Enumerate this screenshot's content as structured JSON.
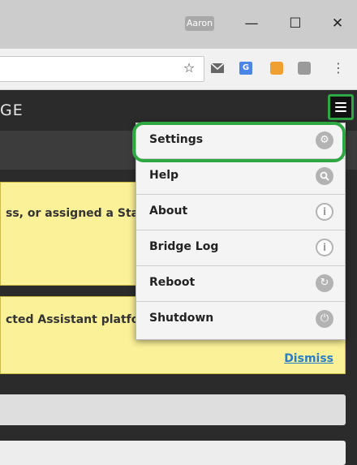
{
  "browser": {
    "user_name": "Aaron",
    "window_controls": {
      "minimize": "—",
      "maximize": "☐",
      "close": "✕"
    },
    "toolbar_icons": [
      "star-icon",
      "mail-icon",
      "translate-icon",
      "extension-orange-icon",
      "extension-grey-icon",
      "kebab-menu-icon"
    ]
  },
  "app": {
    "title_fragment": "GE",
    "menu_items": [
      {
        "label": "Settings",
        "icon": "gear-icon"
      },
      {
        "label": "Help",
        "icon": "search-icon"
      },
      {
        "label": "About",
        "icon": "info-icon"
      },
      {
        "label": "Bridge Log",
        "icon": "info-icon"
      },
      {
        "label": "Reboot",
        "icon": "refresh-icon"
      },
      {
        "label": "Shutdown",
        "icon": "power-icon"
      }
    ],
    "notices": [
      {
        "text": "ss, or assigned a Sta"
      },
      {
        "text": "cted Assistant platfo",
        "dismiss_label": "Dismiss"
      }
    ]
  },
  "colors": {
    "highlight": "#2fa843",
    "notice_bg": "#fbf198",
    "link": "#2a7fc2"
  }
}
